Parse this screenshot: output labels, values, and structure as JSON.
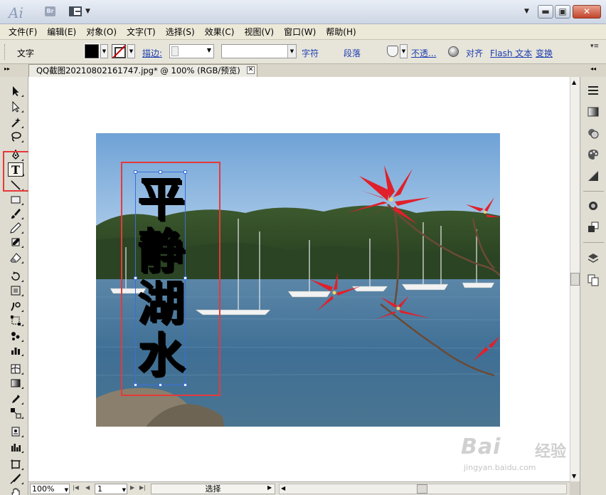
{
  "window": {
    "app_logo": "Ai",
    "bridge_label": "Br",
    "min_label": "▬",
    "max_label": "▣",
    "close_label": "✕"
  },
  "menu": [
    "文件(F)",
    "编辑(E)",
    "对象(O)",
    "文字(T)",
    "选择(S)",
    "效果(C)",
    "视图(V)",
    "窗口(W)",
    "帮助(H)"
  ],
  "control_bar": {
    "tool_label": "文字",
    "stroke_label": "描边:",
    "character_link": "字符",
    "paragraph_link": "段落",
    "opacity_link": "不透...",
    "align_link": "对齐",
    "flash_text_link": "Flash 文本",
    "transform_link": "变换",
    "fill_color": "#000000",
    "stroke_slash_color": "#cc0000"
  },
  "document_tab": {
    "title": "QQ截图20210802161747.jpg* @ 100% (RGB/预览)",
    "close_label": "✕"
  },
  "canvas": {
    "vertical_text": [
      "平",
      "静",
      "湖",
      "水"
    ],
    "highlight_color": "#e53a3a",
    "selection_color": "#3b6fd9"
  },
  "status_bar": {
    "zoom": "100%",
    "page": "1",
    "status": "选择"
  },
  "watermark": {
    "brand": "Bai",
    "brand_cn": "经验",
    "url": "jingyan.baidu.com"
  }
}
